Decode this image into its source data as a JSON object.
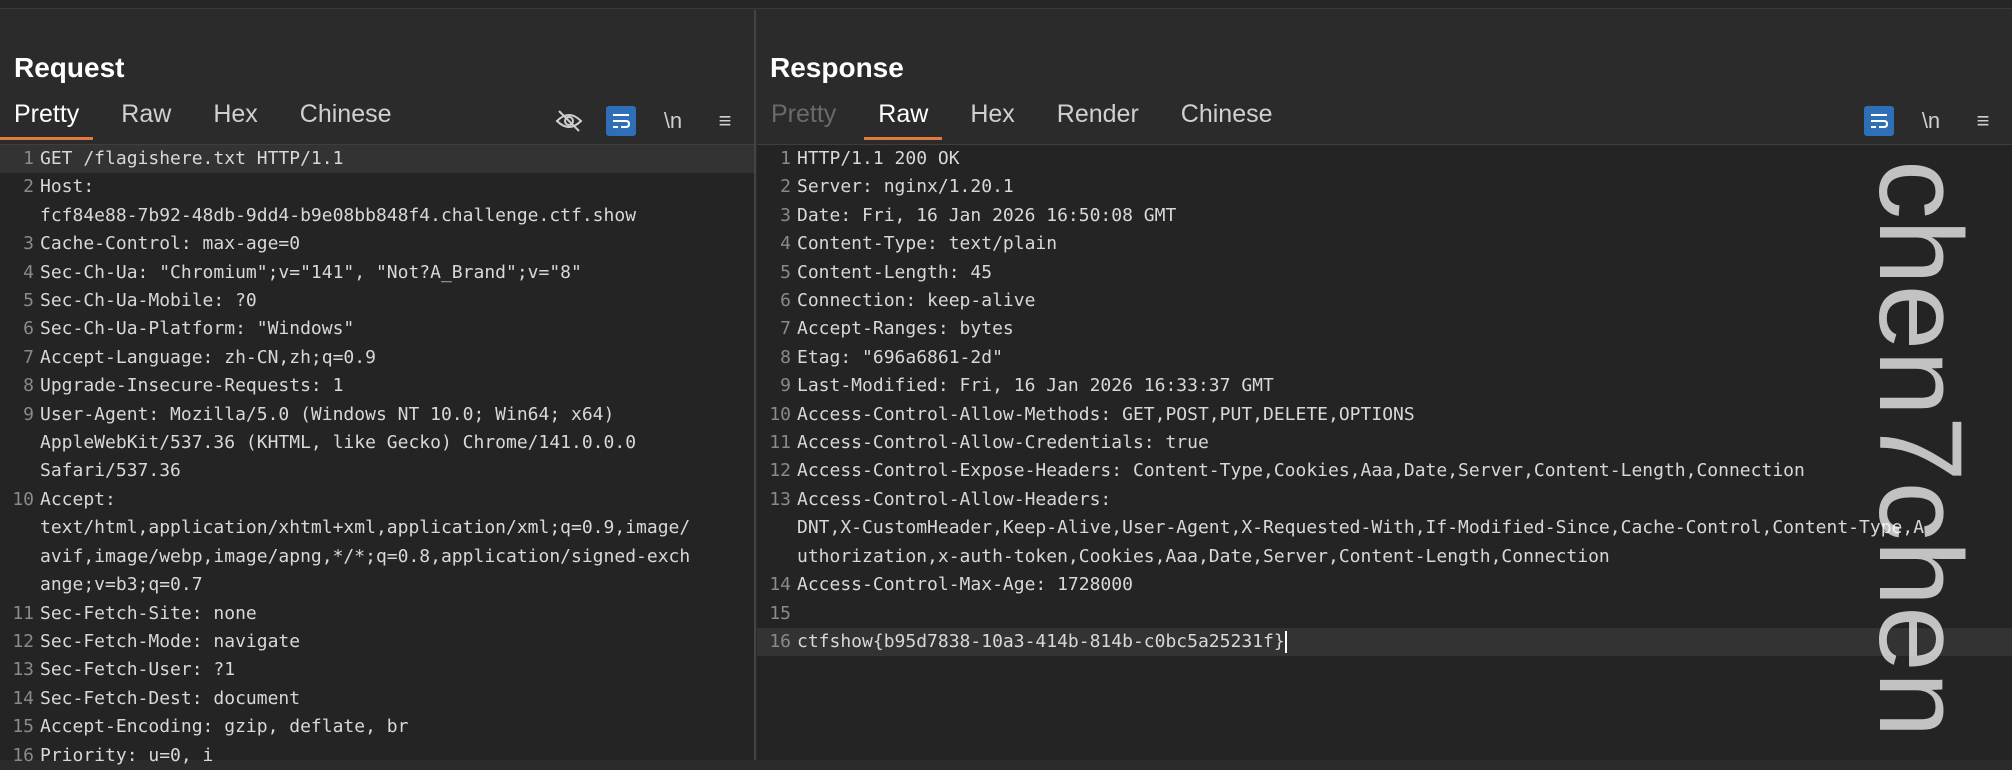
{
  "request": {
    "title": "Request",
    "tabs": [
      "Pretty",
      "Raw",
      "Hex",
      "Chinese"
    ],
    "active_tab": "Pretty",
    "tools": {
      "newline": "\\n",
      "menu": "≡"
    },
    "lines": [
      {
        "n": "1",
        "t": "GET /flagishere.txt HTTP/1.1"
      },
      {
        "n": "2",
        "t": "Host:"
      },
      {
        "n": "",
        "t": "fcf84e88-7b92-48db-9dd4-b9e08bb848f4.challenge.ctf.show"
      },
      {
        "n": "3",
        "t": "Cache-Control: max-age=0"
      },
      {
        "n": "4",
        "t": "Sec-Ch-Ua: \"Chromium\";v=\"141\", \"Not?A_Brand\";v=\"8\""
      },
      {
        "n": "5",
        "t": "Sec-Ch-Ua-Mobile: ?0"
      },
      {
        "n": "6",
        "t": "Sec-Ch-Ua-Platform: \"Windows\""
      },
      {
        "n": "7",
        "t": "Accept-Language: zh-CN,zh;q=0.9"
      },
      {
        "n": "8",
        "t": "Upgrade-Insecure-Requests: 1"
      },
      {
        "n": "9",
        "t": "User-Agent: Mozilla/5.0 (Windows NT 10.0; Win64; x64)"
      },
      {
        "n": "",
        "t": "AppleWebKit/537.36 (KHTML, like Gecko) Chrome/141.0.0.0"
      },
      {
        "n": "",
        "t": "Safari/537.36"
      },
      {
        "n": "10",
        "t": "Accept:"
      },
      {
        "n": "",
        "t": "text/html,application/xhtml+xml,application/xml;q=0.9,image/"
      },
      {
        "n": "",
        "t": "avif,image/webp,image/apng,*/*;q=0.8,application/signed-exch"
      },
      {
        "n": "",
        "t": "ange;v=b3;q=0.7"
      },
      {
        "n": "11",
        "t": "Sec-Fetch-Site: none"
      },
      {
        "n": "12",
        "t": "Sec-Fetch-Mode: navigate"
      },
      {
        "n": "13",
        "t": "Sec-Fetch-User: ?1"
      },
      {
        "n": "14",
        "t": "Sec-Fetch-Dest: document"
      },
      {
        "n": "15",
        "t": "Accept-Encoding: gzip, deflate, br"
      },
      {
        "n": "16",
        "t": "Priority: u=0, i"
      }
    ]
  },
  "response": {
    "title": "Response",
    "tabs": [
      "Pretty",
      "Raw",
      "Hex",
      "Render",
      "Chinese"
    ],
    "active_tab": "Raw",
    "disabled_tab": "Pretty",
    "tools": {
      "newline": "\\n",
      "menu": "≡"
    },
    "lines": [
      {
        "n": "1",
        "t": "HTTP/1.1 200 OK"
      },
      {
        "n": "2",
        "t": "Server: nginx/1.20.1"
      },
      {
        "n": "3",
        "t": "Date: Fri, 16 Jan 2026 16:50:08 GMT"
      },
      {
        "n": "4",
        "t": "Content-Type: text/plain"
      },
      {
        "n": "5",
        "t": "Content-Length: 45"
      },
      {
        "n": "6",
        "t": "Connection: keep-alive"
      },
      {
        "n": "7",
        "t": "Accept-Ranges: bytes"
      },
      {
        "n": "8",
        "t": "Etag: \"696a6861-2d\""
      },
      {
        "n": "9",
        "t": "Last-Modified: Fri, 16 Jan 2026 16:33:37 GMT"
      },
      {
        "n": "10",
        "t": "Access-Control-Allow-Methods: GET,POST,PUT,DELETE,OPTIONS"
      },
      {
        "n": "11",
        "t": "Access-Control-Allow-Credentials: true"
      },
      {
        "n": "12",
        "t": "Access-Control-Expose-Headers: Content-Type,Cookies,Aaa,Date,Server,Content-Length,Connection"
      },
      {
        "n": "13",
        "t": "Access-Control-Allow-Headers:"
      },
      {
        "n": "",
        "t": "DNT,X-CustomHeader,Keep-Alive,User-Agent,X-Requested-With,If-Modified-Since,Cache-Control,Content-Type,A"
      },
      {
        "n": "",
        "t": "uthorization,x-auth-token,Cookies,Aaa,Date,Server,Content-Length,Connection"
      },
      {
        "n": "14",
        "t": "Access-Control-Max-Age: 1728000"
      },
      {
        "n": "15",
        "t": ""
      },
      {
        "n": "16",
        "t": "ctfshow{b95d7838-10a3-414b-814b-c0bc5a25231f}"
      }
    ]
  },
  "watermark": "chen7chen",
  "colors": {
    "accent": "#e07a3f",
    "button": "#2f6fb8"
  },
  "icons": [
    "eye-off-icon",
    "wrap-icon",
    "newline-icon",
    "menu-icon",
    "layout-split-icon",
    "layout-rows-icon",
    "layout-single-icon"
  ]
}
